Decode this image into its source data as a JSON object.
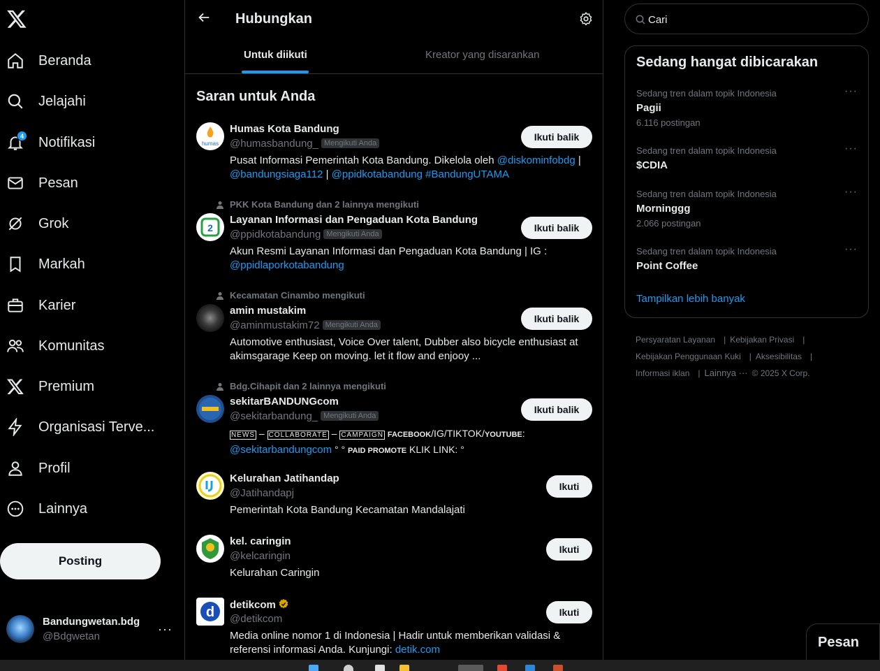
{
  "nav": {
    "items": [
      {
        "label": "Beranda",
        "icon": "home-icon"
      },
      {
        "label": "Jelajahi",
        "icon": "search-icon"
      },
      {
        "label": "Notifikasi",
        "icon": "bell-icon",
        "badge": "4"
      },
      {
        "label": "Pesan",
        "icon": "mail-icon"
      },
      {
        "label": "Grok",
        "icon": "grok-icon"
      },
      {
        "label": "Markah",
        "icon": "bookmark-icon"
      },
      {
        "label": "Karier",
        "icon": "briefcase-icon"
      },
      {
        "label": "Komunitas",
        "icon": "people-icon"
      },
      {
        "label": "Premium",
        "icon": "x-logo-icon"
      },
      {
        "label": "Organisasi Terve...",
        "icon": "lightning-icon"
      },
      {
        "label": "Profil",
        "icon": "person-icon"
      },
      {
        "label": "Lainnya",
        "icon": "more-circle-icon"
      }
    ],
    "post_label": "Posting"
  },
  "account": {
    "name": "Bandungwetan.bdg",
    "handle": "@Bdgwetan",
    "more": "···"
  },
  "main": {
    "title": "Hubungkan",
    "tabs": [
      {
        "label": "Untuk diikuti"
      },
      {
        "label": "Kreator yang disarankan"
      }
    ],
    "section_title": "Saran untuk Anda",
    "follows_you": "Mengikuti Anda",
    "follow_back_label": "Ikuti balik",
    "follow_label": "Ikuti",
    "suggestions": [
      {
        "context": "",
        "name": "Humas Kota Bandung",
        "handle": "@humasbandung_",
        "follows_you": true,
        "button": "Ikuti balik",
        "bio_text1": "Pusat Informasi Pemerintah Kota Bandung. Dikelola oleh ",
        "bio_link1": "@diskominfobdg",
        "bio_text2": " | ",
        "bio_link2": "@bandungsiaga112",
        "bio_text3": " | ",
        "bio_link3": "@ppidkotabandung",
        "bio_text4": " ",
        "bio_link4": "#BandungUTAMA"
      },
      {
        "context": "PKK Kota Bandung dan 2 lainnya mengikuti",
        "name": "Layanan Informasi dan Pengaduan Kota Bandung",
        "handle": "@ppidkotabandung",
        "follows_you": true,
        "button": "Ikuti balik",
        "bio_text1": "Akun Resmi Layanan Informasi dan Pengaduan Kota Bandung | IG : ",
        "bio_link1": "@ppidlaporkotabandung"
      },
      {
        "context": "Kecamatan Cinambo mengikuti",
        "name": "amin mustakim",
        "handle": "@aminmustakim72",
        "follows_you": true,
        "button": "Ikuti balik",
        "bio_text1": "Automotive enthusiast, Voice Over talent, Dubber also bicycle enthusiast at akimsgarage Keep on moving. let it flow and enjooy ..."
      },
      {
        "context": "Bdg.Cihapit dan 2 lainnya mengikuti",
        "name": "sekitarBANDUNGcom",
        "handle": "@sekitarbandung_",
        "follows_you": true,
        "button": "Ikuti balik",
        "bio_box1": "NEWS",
        "bio_box2": "COLLABORATE",
        "bio_box3": "CAMPAIGN",
        "bio_sc1": "FACEBOOK",
        "bio_mid": "/IG/TIKTOK/",
        "bio_sc2": "YOUTUBE",
        "bio_colon": ":",
        "bio_link1": "@sekitarbandungcom",
        "bio_text2": " ° ° ",
        "bio_sc3": "PAID PROMOTE",
        "bio_text3": " KLIK LINK: °",
        "bio_dash": " – "
      },
      {
        "context": "",
        "name": "Kelurahan Jatihandap",
        "handle": "@Jatihandapj",
        "follows_you": false,
        "button": "Ikuti",
        "bio_text1": "Pemerintah Kota Bandung Kecamatan Mandalajati"
      },
      {
        "context": "",
        "name": "kel. caringin",
        "handle": "@kelcaringin",
        "follows_you": false,
        "button": "Ikuti",
        "bio_text1": "Kelurahan Caringin"
      },
      {
        "context": "",
        "name": "detikcom",
        "handle": "@detikcom",
        "follows_you": false,
        "button": "Ikuti",
        "verified": true,
        "bio_text1": "Media online nomor 1 di Indonesia | Hadir untuk memberikan validasi & referensi informasi Anda. Kunjungi: ",
        "bio_link1": "detik.com"
      }
    ]
  },
  "search": {
    "value": "Cari"
  },
  "trends": {
    "title": "Sedang hangat dibicarakan",
    "items": [
      {
        "meta": "Sedang tren dalam topik Indonesia",
        "name": "Pagii",
        "count": "6.116 postingan"
      },
      {
        "meta": "Sedang tren dalam topik Indonesia",
        "name": "$CDIA",
        "count": ""
      },
      {
        "meta": "Sedang tren dalam topik Indonesia",
        "name": "Morninggg",
        "count": "2.066 postingan"
      },
      {
        "meta": "Sedang tren dalam topik Indonesia",
        "name": "Point Coffee",
        "count": ""
      }
    ],
    "more_dots": "···",
    "show_more": "Tampilkan lebih banyak"
  },
  "footer": {
    "links": [
      "Persyaratan Layanan",
      "Kebijakan Privasi",
      "Kebijakan Penggunaan Kuki",
      "Aksesibilitas",
      "Informasi iklan",
      "Lainnya ···"
    ],
    "sep": "|",
    "copyright": "© 2025 X Corp."
  },
  "messages_label": "Pesan",
  "colors": {
    "accent": "#1d9bf0",
    "bg": "#000000",
    "border": "#2f3336",
    "muted": "#71767b",
    "text": "#e7e9ea"
  }
}
